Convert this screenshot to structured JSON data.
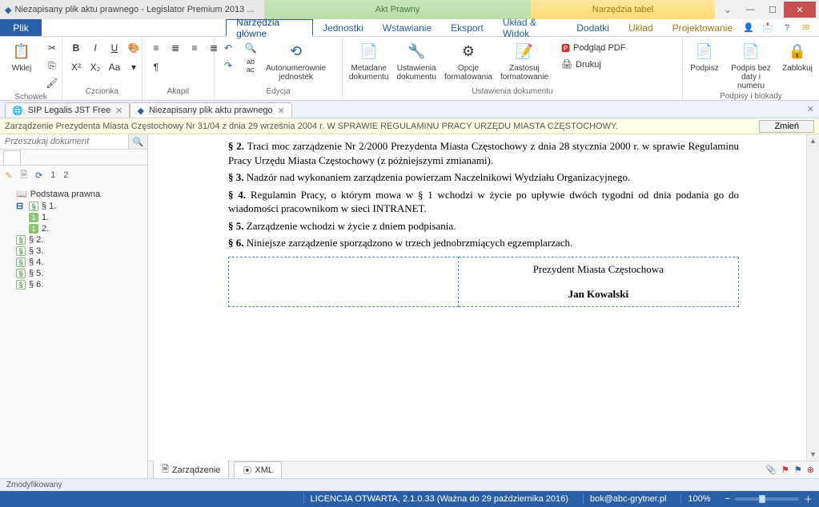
{
  "title": {
    "app": "Niezapisany plik aktu prawnego - Legislator Premium 2013 ...",
    "center": "Akt Prawny",
    "right": "Narzędzia tabel"
  },
  "ribbon": {
    "file": "Plik",
    "tabs": [
      "Narzędzia główne",
      "Jednostki",
      "Wstawianie",
      "Eksport",
      "Układ & Widok",
      "Dodatki",
      "Układ",
      "Projektowanie"
    ],
    "groups": {
      "schowek": {
        "label": "Schowek",
        "paste": "Wklej"
      },
      "czcionka": {
        "label": "Czcionka"
      },
      "akapit": {
        "label": "Akapit"
      },
      "edycja": {
        "label": "Edycja",
        "auton": "Autonumerownie\njednostek"
      },
      "ustdoc": {
        "label": "Ustawienia dokumentu",
        "meta": "Metadane\ndokumentu",
        "ust": "Ustawienia\ndokumentu",
        "opcje": "Opcje\nformatowania",
        "zast": "Zastosuj\nformatowanie",
        "podglad": "Podgląd PDF",
        "drukuj": "Drukuj"
      },
      "podpisy": {
        "label": "Podpisy i blokady",
        "podpisz": "Podpisz",
        "podbez": "Podpis bez\ndaty i numeru",
        "zablokuj": "Zablokuj"
      }
    }
  },
  "doc_tabs": [
    {
      "name": "SIP Legalis JST Free",
      "active": false
    },
    {
      "name": "Niezapisany plik aktu prawnego",
      "active": true
    }
  ],
  "infobar": {
    "text": "Zarządzenie Prezydenta Miasta Częstochowy Nr 31/04 z dnia 29 września 2004 r. W SPRAWIE REGULAMINU PRACY URZĘDU MIASTA CZĘSTOCHOWY.",
    "btn": "Zmień"
  },
  "search": {
    "placeholder": "Przeszukaj dokument"
  },
  "tree_tb": {
    "n1": "1",
    "n2": "2"
  },
  "tree": {
    "root": "Podstawa prawna",
    "s1": "§ 1.",
    "s1_1": "1.",
    "s1_2": "2.",
    "s2": "§ 2.",
    "s3": "§ 3.",
    "s4": "§ 4.",
    "s5": "§ 5.",
    "s6": "§ 6."
  },
  "doc": {
    "p2a": "§ 2.",
    "p2": "Traci moc zarządzenie Nr 2/2000 Prezydenta Miasta Częstochowy z dnia 28 stycznia 2000 r. w sprawie Regulaminu Pracy Urzędu Miasta Częstochowy (z późniejszymi zmianami).",
    "p3a": "§ 3.",
    "p3": "Nadzór nad wykonaniem zarządzenia powierzam Naczelnikowi Wydziału Organizacyjnego.",
    "p4a": "§ 4.",
    "p4": "Regulamin Pracy, o którym mowa w § 1 wchodzi w życie po upływie dwóch tygodni od dnia podania go do wiadomości pracownikom w sieci INTRANET.",
    "p5a": "§ 5.",
    "p5": "Zarządzenie wchodzi w życie z dniem podpisania.",
    "p6a": "§ 6.",
    "p6": "Niniejsze zarządzenie sporządzono w trzech jednobrzmiących egzemplarzach.",
    "sig_title": "Prezydent Miasta Częstochowa",
    "sig_name": "Jan Kowalski"
  },
  "bottom_tabs": {
    "a": "Zarządzenie",
    "b": "XML"
  },
  "mini_status": "Zmodyfikowany",
  "status": {
    "license": "LICENCJA OTWARTA, 2.1.0.33 (Ważna do 29 października 2016)",
    "email": "bok@abc-grytner.pl",
    "zoom": "100%"
  }
}
